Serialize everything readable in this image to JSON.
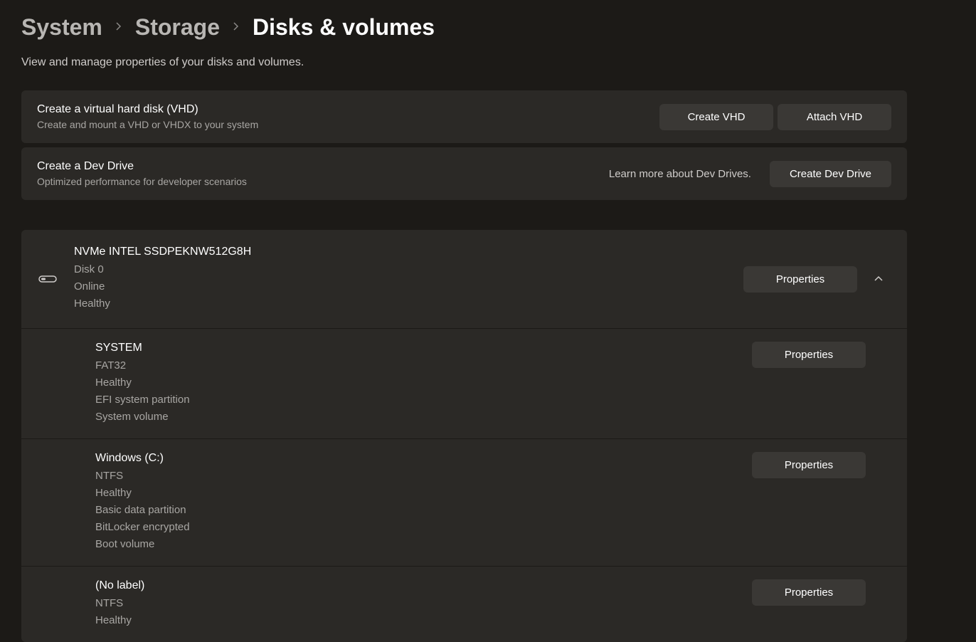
{
  "breadcrumb": {
    "level1": "System",
    "level2": "Storage",
    "current": "Disks & volumes"
  },
  "subtitle": "View and manage properties of your disks and volumes.",
  "vhd_card": {
    "title": "Create a virtual hard disk (VHD)",
    "desc": "Create and mount a VHD or VHDX to your system",
    "create_btn": "Create VHD",
    "attach_btn": "Attach VHD"
  },
  "devdrive_card": {
    "title": "Create a Dev Drive",
    "desc": "Optimized performance for developer scenarios",
    "learn_more": "Learn more about Dev Drives.",
    "create_btn": "Create Dev Drive"
  },
  "properties_label": "Properties",
  "disk": {
    "name": "NVMe INTEL SSDPEKNW512G8H",
    "id": "Disk 0",
    "status": "Online",
    "health": "Healthy"
  },
  "volumes": [
    {
      "name": "SYSTEM",
      "lines": [
        "FAT32",
        "Healthy",
        "EFI system partition",
        "System volume"
      ]
    },
    {
      "name": "Windows (C:)",
      "lines": [
        "NTFS",
        "Healthy",
        "Basic data partition",
        "BitLocker encrypted",
        "Boot volume"
      ]
    },
    {
      "name": "(No label)",
      "lines": [
        "NTFS",
        "Healthy"
      ]
    }
  ]
}
